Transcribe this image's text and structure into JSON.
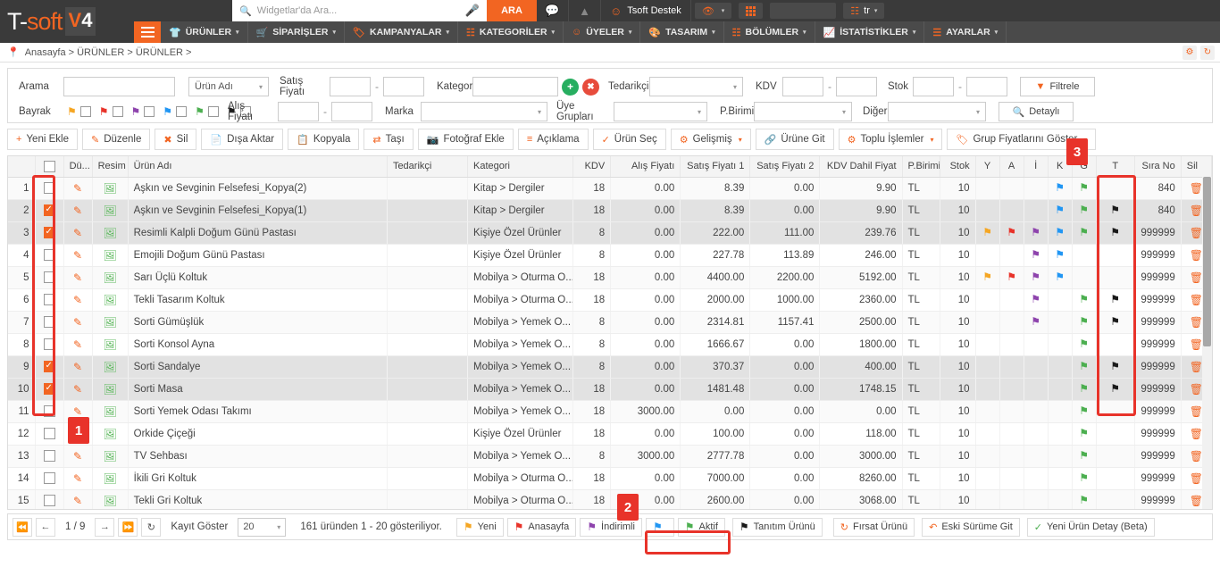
{
  "brand": {
    "logo_t": "T-",
    "logo_soft": "soft",
    "logo_v": "V",
    "logo_4": "4"
  },
  "topbar": {
    "search_placeholder": "Widgetlar'da Ara...",
    "search_icon": "search-icon",
    "mic_icon": "microphone-icon",
    "search_button": "ARA",
    "chat_icon": "chat-icon",
    "warning_icon": "warning-icon",
    "user_icon": "user-icon",
    "user_name": "Tsoft Destek",
    "eye_icon": "eye-icon",
    "grid_icon": "grid-icon",
    "lang_icon": "language-icon",
    "lang_label": "tr"
  },
  "menu": {
    "hamburger": "hamburger-icon",
    "items": [
      {
        "label": "ÜRÜNLER",
        "icon": "shirt-icon",
        "caret": "▾"
      },
      {
        "label": "SİPARİŞLER",
        "icon": "cart-icon",
        "caret": "▾"
      },
      {
        "label": "KAMPANYALAR",
        "icon": "tag-icon",
        "caret": "▾"
      },
      {
        "label": "KATEGORİLER",
        "icon": "sitemap-icon",
        "caret": "▾"
      },
      {
        "label": "ÜYELER",
        "icon": "member-icon",
        "caret": "▾"
      },
      {
        "label": "TASARIM",
        "icon": "brush-icon",
        "caret": "▾"
      },
      {
        "label": "BÖLÜMLER",
        "icon": "nodes-icon",
        "caret": "▾"
      },
      {
        "label": "İSTATİSTİKLER",
        "icon": "chart-icon",
        "caret": "▾"
      },
      {
        "label": "AYARLAR",
        "icon": "sliders-icon",
        "caret": "▾"
      }
    ]
  },
  "breadcrumb": {
    "pin_icon": "location-pin-icon",
    "text": "Anasayfa > ÜRÜNLER > ÜRÜNLER >"
  },
  "filters": {
    "arama_label": "Arama",
    "arama_value": "",
    "urun_adi_select": "Ürün Adı",
    "satis_fiyati_label": "Satış Fiyatı",
    "satis_min": "",
    "satis_max": "",
    "kategori_label": "Kategori",
    "kategori_value": "",
    "kategori_add_icon": "plus-circle-icon",
    "kategori_clear_icon": "close-circle-icon",
    "tedarikci_label": "Tedarikçi",
    "tedarikci_value": "",
    "kdv_label": "KDV",
    "kdv_min": "",
    "kdv_max": "",
    "stok_label": "Stok",
    "stok_min": "",
    "stok_max": "",
    "filtrele_label": "Filtrele",
    "filtrele_icon": "funnel-icon",
    "bayrak_label": "Bayrak",
    "bayrak_flags": [
      "#f5a623",
      "#e8332a",
      "#8e44ad",
      "#2196f3",
      "#4caf50",
      "#1a1a1a"
    ],
    "alis_fiyati_label": "Alış Fiyatı",
    "alis_min": "",
    "alis_max": "",
    "marka_label": "Marka",
    "marka_value": "",
    "uye_gruplari_label": "Üye Grupları",
    "uye_gruplari_value": "",
    "pbirimi_label": "P.Birimi",
    "pbirimi_value": "",
    "diger_label": "Diğer",
    "diger_value": "",
    "detayli_label": "Detaylı",
    "detayli_icon": "search-icon"
  },
  "toolbar": [
    {
      "label": "Yeni Ekle",
      "icon": "plus-icon",
      "caret": false
    },
    {
      "label": "Düzenle",
      "icon": "pencil-icon",
      "caret": false
    },
    {
      "label": "Sil",
      "icon": "x-icon",
      "caret": false
    },
    {
      "label": "Dışa Aktar",
      "icon": "excel-icon",
      "caret": false
    },
    {
      "label": "Kopyala",
      "icon": "copy-icon",
      "caret": false
    },
    {
      "label": "Taşı",
      "icon": "move-icon",
      "caret": false
    },
    {
      "label": "Fotoğraf Ekle",
      "icon": "photo-icon",
      "caret": false
    },
    {
      "label": "Açıklama",
      "icon": "lines-icon",
      "caret": false
    },
    {
      "label": "Ürün Seç",
      "icon": "check-icon",
      "caret": false
    },
    {
      "label": "Gelişmiş",
      "icon": "gear-icon",
      "caret": true
    },
    {
      "label": "Ürüne Git",
      "icon": "link-icon",
      "caret": false
    },
    {
      "label": "Toplu İşlemler",
      "icon": "gears-icon",
      "caret": true
    },
    {
      "label": "Grup Fiyatlarını Göster",
      "icon": "tags-icon",
      "caret": true
    }
  ],
  "table": {
    "columns": [
      "",
      "",
      "Dü...",
      "Resim",
      "Ürün Adı",
      "Tedarikçi",
      "Kategori",
      "KDV",
      "Alış Fiyatı",
      "Satış Fiyatı 1",
      "Satış Fiyatı 2",
      "KDV Dahil Fiyat",
      "P.Birimi",
      "Stok",
      "Y",
      "A",
      "İ",
      "K",
      "G",
      "T",
      "Sıra No",
      "Sil"
    ],
    "rows": [
      {
        "no": "1",
        "checked": false,
        "name": "Aşkın ve Sevginin Felsefesi_Kopya(2)",
        "tedarikci": "",
        "kategori": "Kitap > Dergiler",
        "kdv": "18",
        "alis": "0.00",
        "satis1": "8.39",
        "satis2": "0.00",
        "kdvdahil": "9.90",
        "pbirimi": "TL",
        "stok": "10",
        "Y": "",
        "A": "",
        "I": "",
        "K": "#2196f3",
        "G": "#4caf50",
        "T": "",
        "sirano": "840"
      },
      {
        "no": "2",
        "checked": true,
        "name": "Aşkın ve Sevginin Felsefesi_Kopya(1)",
        "tedarikci": "",
        "kategori": "Kitap > Dergiler",
        "kdv": "18",
        "alis": "0.00",
        "satis1": "8.39",
        "satis2": "0.00",
        "kdvdahil": "9.90",
        "pbirimi": "TL",
        "stok": "10",
        "Y": "",
        "A": "",
        "I": "",
        "K": "#2196f3",
        "G": "#4caf50",
        "T": "#1a1a1a",
        "sirano": "840"
      },
      {
        "no": "3",
        "checked": true,
        "name": "Resimli Kalpli Doğum Günü Pastası",
        "tedarikci": "",
        "kategori": "Kişiye Özel Ürünler",
        "kdv": "8",
        "alis": "0.00",
        "satis1": "222.00",
        "satis2": "111.00",
        "kdvdahil": "239.76",
        "pbirimi": "TL",
        "stok": "10",
        "Y": "#f5a623",
        "A": "#e8332a",
        "I": "#8e44ad",
        "K": "#2196f3",
        "G": "#4caf50",
        "T": "#1a1a1a",
        "sirano": "999999"
      },
      {
        "no": "4",
        "checked": false,
        "name": "Emojili Doğum Günü Pastası",
        "tedarikci": "",
        "kategori": "Kişiye Özel Ürünler",
        "kdv": "8",
        "alis": "0.00",
        "satis1": "227.78",
        "satis2": "113.89",
        "kdvdahil": "246.00",
        "pbirimi": "TL",
        "stok": "10",
        "Y": "",
        "A": "",
        "I": "#8e44ad",
        "K": "#2196f3",
        "G": "",
        "T": "",
        "sirano": "999999"
      },
      {
        "no": "5",
        "checked": false,
        "name": "Sarı Üçlü Koltuk",
        "tedarikci": "",
        "kategori": "Mobilya > Oturma O...",
        "kdv": "18",
        "alis": "0.00",
        "satis1": "4400.00",
        "satis2": "2200.00",
        "kdvdahil": "5192.00",
        "pbirimi": "TL",
        "stok": "10",
        "Y": "#f5a623",
        "A": "#e8332a",
        "I": "#8e44ad",
        "K": "#2196f3",
        "G": "",
        "T": "",
        "sirano": "999999"
      },
      {
        "no": "6",
        "checked": false,
        "name": "Tekli Tasarım Koltuk",
        "tedarikci": "",
        "kategori": "Mobilya > Oturma O...",
        "kdv": "18",
        "alis": "0.00",
        "satis1": "2000.00",
        "satis2": "1000.00",
        "kdvdahil": "2360.00",
        "pbirimi": "TL",
        "stok": "10",
        "Y": "",
        "A": "",
        "I": "#8e44ad",
        "K": "",
        "G": "#4caf50",
        "T": "#1a1a1a",
        "sirano": "999999"
      },
      {
        "no": "7",
        "checked": false,
        "name": "Sorti Gümüşlük",
        "tedarikci": "",
        "kategori": "Mobilya > Yemek O...",
        "kdv": "8",
        "alis": "0.00",
        "satis1": "2314.81",
        "satis2": "1157.41",
        "kdvdahil": "2500.00",
        "pbirimi": "TL",
        "stok": "10",
        "Y": "",
        "A": "",
        "I": "#8e44ad",
        "K": "",
        "G": "#4caf50",
        "T": "#1a1a1a",
        "sirano": "999999"
      },
      {
        "no": "8",
        "checked": false,
        "name": "Sorti Konsol Ayna",
        "tedarikci": "",
        "kategori": "Mobilya > Yemek O...",
        "kdv": "8",
        "alis": "0.00",
        "satis1": "1666.67",
        "satis2": "0.00",
        "kdvdahil": "1800.00",
        "pbirimi": "TL",
        "stok": "10",
        "Y": "",
        "A": "",
        "I": "",
        "K": "",
        "G": "#4caf50",
        "T": "",
        "sirano": "999999"
      },
      {
        "no": "9",
        "checked": true,
        "name": "Sorti Sandalye",
        "tedarikci": "",
        "kategori": "Mobilya > Yemek O...",
        "kdv": "8",
        "alis": "0.00",
        "satis1": "370.37",
        "satis2": "0.00",
        "kdvdahil": "400.00",
        "pbirimi": "TL",
        "stok": "10",
        "Y": "",
        "A": "",
        "I": "",
        "K": "",
        "G": "#4caf50",
        "T": "#1a1a1a",
        "sirano": "999999"
      },
      {
        "no": "10",
        "checked": true,
        "name": "Sorti Masa",
        "tedarikci": "",
        "kategori": "Mobilya > Yemek O...",
        "kdv": "18",
        "alis": "0.00",
        "satis1": "1481.48",
        "satis2": "0.00",
        "kdvdahil": "1748.15",
        "pbirimi": "TL",
        "stok": "10",
        "Y": "",
        "A": "",
        "I": "",
        "K": "",
        "G": "#4caf50",
        "T": "#1a1a1a",
        "sirano": "999999"
      },
      {
        "no": "11",
        "checked": false,
        "name": "Sorti Yemek Odası Takımı",
        "tedarikci": "",
        "kategori": "Mobilya > Yemek O...",
        "kdv": "18",
        "alis": "3000.00",
        "satis1": "0.00",
        "satis2": "0.00",
        "kdvdahil": "0.00",
        "pbirimi": "TL",
        "stok": "10",
        "Y": "",
        "A": "",
        "I": "",
        "K": "",
        "G": "#4caf50",
        "T": "",
        "sirano": "999999"
      },
      {
        "no": "12",
        "checked": false,
        "name": "Orkide Çiçeği",
        "tedarikci": "",
        "kategori": "Kişiye Özel Ürünler",
        "kdv": "18",
        "alis": "0.00",
        "satis1": "100.00",
        "satis2": "0.00",
        "kdvdahil": "118.00",
        "pbirimi": "TL",
        "stok": "10",
        "Y": "",
        "A": "",
        "I": "",
        "K": "",
        "G": "#4caf50",
        "T": "",
        "sirano": "999999"
      },
      {
        "no": "13",
        "checked": false,
        "name": "TV Sehbası",
        "tedarikci": "",
        "kategori": "Mobilya > Yemek O...",
        "kdv": "8",
        "alis": "3000.00",
        "satis1": "2777.78",
        "satis2": "0.00",
        "kdvdahil": "3000.00",
        "pbirimi": "TL",
        "stok": "10",
        "Y": "",
        "A": "",
        "I": "",
        "K": "",
        "G": "#4caf50",
        "T": "",
        "sirano": "999999"
      },
      {
        "no": "14",
        "checked": false,
        "name": "İkili Gri Koltuk",
        "tedarikci": "",
        "kategori": "Mobilya > Oturma O...",
        "kdv": "18",
        "alis": "0.00",
        "satis1": "7000.00",
        "satis2": "0.00",
        "kdvdahil": "8260.00",
        "pbirimi": "TL",
        "stok": "10",
        "Y": "",
        "A": "",
        "I": "",
        "K": "",
        "G": "#4caf50",
        "T": "",
        "sirano": "999999"
      },
      {
        "no": "15",
        "checked": false,
        "name": "Tekli Gri Koltuk",
        "tedarikci": "",
        "kategori": "Mobilya > Oturma O...",
        "kdv": "18",
        "alis": "0.00",
        "satis1": "2600.00",
        "satis2": "0.00",
        "kdvdahil": "3068.00",
        "pbirimi": "TL",
        "stok": "10",
        "Y": "",
        "A": "",
        "I": "",
        "K": "",
        "G": "#4caf50",
        "T": "",
        "sirano": "999999"
      }
    ]
  },
  "footer": {
    "first_icon": "first-page-icon",
    "prev_icon": "prev-page-icon",
    "page_text": "1 / 9",
    "next_icon": "next-page-icon",
    "last_icon": "last-page-icon",
    "refresh_icon": "refresh-icon",
    "kayit_goster_label": "Kayıt Göster",
    "page_size": "20",
    "summary": "161 üründen 1 - 20 gösteriliyor.",
    "flag_buttons": [
      {
        "label": "Yeni",
        "color": "#f5a623"
      },
      {
        "label": "Anasayfa",
        "color": "#e8332a"
      },
      {
        "label": "İndirimli",
        "color": "#8e44ad"
      },
      {
        "label": "",
        "color": "#2196f3"
      },
      {
        "label": "Aktif",
        "color": "#4caf50"
      },
      {
        "label": "Tanıtım Ürünü",
        "color": "#1a1a1a"
      }
    ],
    "firsat_label": "Fırsat Ürünü",
    "firsat_icon": "refresh-circle-icon",
    "eski_surum_label": "Eski Sürüme Git",
    "eski_surum_icon": "undo-icon",
    "yeni_detay_label": "Yeni Ürün Detay (Beta)",
    "yeni_detay_icon": "check-icon"
  },
  "annotations": [
    {
      "num": "1"
    },
    {
      "num": "2"
    },
    {
      "num": "3"
    }
  ]
}
